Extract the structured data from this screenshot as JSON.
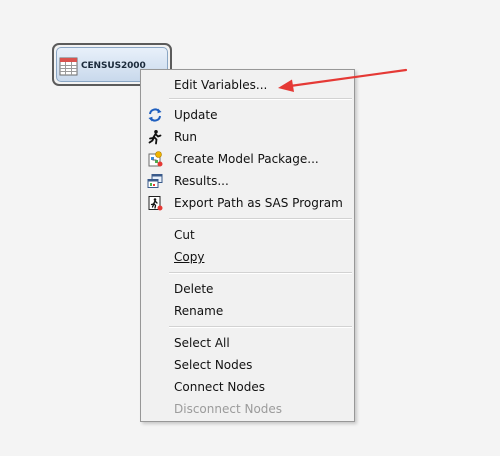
{
  "node": {
    "label": "CENSUS2000",
    "icon": "data-table-icon"
  },
  "context_menu": {
    "items": [
      {
        "label": "Edit Variables...",
        "icon": null,
        "enabled": true
      },
      {
        "label": "Update",
        "icon": "update-icon",
        "enabled": true
      },
      {
        "label": "Run",
        "icon": "run-icon",
        "enabled": true
      },
      {
        "label": "Create Model Package...",
        "icon": "model-package-icon",
        "enabled": true
      },
      {
        "label": "Results...",
        "icon": "results-icon",
        "enabled": true
      },
      {
        "label": "Export Path as SAS Program",
        "icon": "export-path-icon",
        "enabled": true
      },
      {
        "label": "Cut",
        "icon": null,
        "enabled": true
      },
      {
        "label": "Copy",
        "icon": null,
        "enabled": true
      },
      {
        "label": "Delete",
        "icon": null,
        "enabled": true
      },
      {
        "label": "Rename",
        "icon": null,
        "enabled": true
      },
      {
        "label": "Select All",
        "icon": null,
        "enabled": true
      },
      {
        "label": "Select Nodes",
        "icon": null,
        "enabled": true
      },
      {
        "label": "Connect Nodes",
        "icon": null,
        "enabled": true
      },
      {
        "label": "Disconnect Nodes",
        "icon": null,
        "enabled": false
      }
    ]
  },
  "annotation": {
    "arrow_color": "#e53935"
  }
}
